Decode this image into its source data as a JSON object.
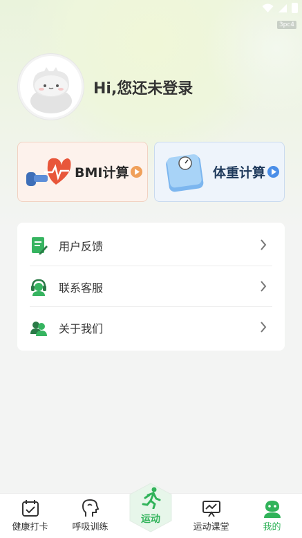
{
  "status_bar": {
    "badge": "3pc4"
  },
  "profile": {
    "login_prompt": "Hi,您还未登录"
  },
  "calculators": {
    "bmi_label": "BMI计算",
    "weight_label": "体重计算"
  },
  "menu": {
    "items": [
      {
        "label": "用户反馈",
        "icon": "feedback-icon"
      },
      {
        "label": "联系客服",
        "icon": "customer-service-icon"
      },
      {
        "label": "关于我们",
        "icon": "about-us-icon"
      }
    ]
  },
  "tabbar": {
    "tabs": [
      {
        "label": "健康打卡",
        "icon": "calendar-check-icon"
      },
      {
        "label": "呼吸训练",
        "icon": "head-breath-icon"
      },
      {
        "label": "运动",
        "icon": "running-man-icon"
      },
      {
        "label": "运动课堂",
        "icon": "chart-board-icon"
      },
      {
        "label": "我的",
        "icon": "user-profile-icon"
      }
    ],
    "active_tab": "我的"
  },
  "colors": {
    "accent_green": "#31b35a",
    "bmi_orange": "#f0a05a",
    "weight_blue": "#4a8ee8"
  }
}
